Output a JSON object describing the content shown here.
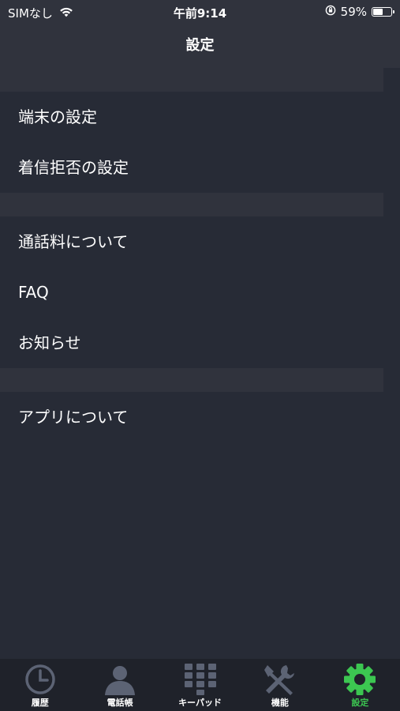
{
  "status_bar": {
    "carrier": "SIMなし",
    "time": "午前9:14",
    "battery_percent": "59%",
    "battery_level": 0.59,
    "icons": [
      "wifi-icon",
      "orientation-lock-icon",
      "battery-icon"
    ]
  },
  "nav": {
    "title": "設定"
  },
  "sections": [
    {
      "items": [
        {
          "label": "端末の設定"
        },
        {
          "label": "着信拒否の設定"
        }
      ]
    },
    {
      "items": [
        {
          "label": "通話料について"
        },
        {
          "label": "FAQ"
        },
        {
          "label": "お知らせ"
        }
      ]
    },
    {
      "items": [
        {
          "label": "アプリについて"
        }
      ]
    }
  ],
  "tabs": [
    {
      "label": "履歴",
      "icon": "clock-icon",
      "active": false
    },
    {
      "label": "電話帳",
      "icon": "person-icon",
      "active": false
    },
    {
      "label": "キーパッド",
      "icon": "keypad-icon",
      "active": false
    },
    {
      "label": "機能",
      "icon": "tools-icon",
      "active": false
    },
    {
      "label": "設定",
      "icon": "gear-icon",
      "active": true
    }
  ],
  "colors": {
    "background": "#272b36",
    "section_separator": "#30333d",
    "tab_bar": "#1f222a",
    "inactive_icon": "#5c6374",
    "active_accent": "#3cc651"
  }
}
